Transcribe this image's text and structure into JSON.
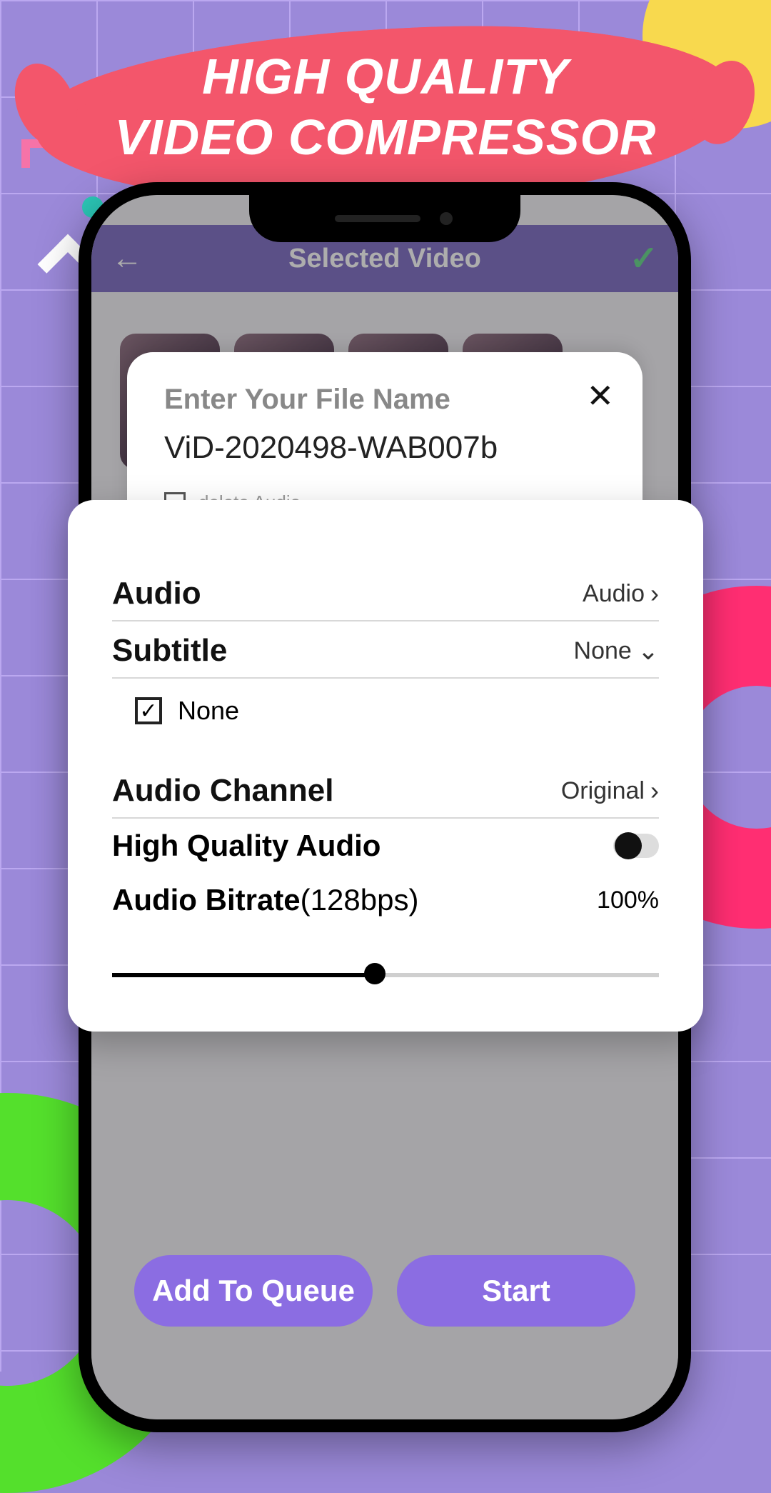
{
  "banner": {
    "line1": "HIGH QUALITY",
    "line2": "VIDEO COMPRESSOR"
  },
  "topbar": {
    "title": "Selected Video"
  },
  "sheet1": {
    "label": "Enter Your File Name",
    "filename": "ViD-2020498-WAB007b",
    "delete_audio": "delete Audio"
  },
  "settings": {
    "audio": {
      "label": "Audio",
      "value": "Audio"
    },
    "subtitle": {
      "label": "Subtitle",
      "value": "None",
      "checkbox_label": "None"
    },
    "channel": {
      "label": "Audio Channel",
      "value": "Original"
    },
    "hq": {
      "label": "High Quality Audio"
    },
    "bitrate": {
      "label": "Audio Bitrate",
      "sub": "(128bps)",
      "value": "100%"
    }
  },
  "buttons": {
    "queue": "Add To Queue",
    "start": "Start"
  }
}
